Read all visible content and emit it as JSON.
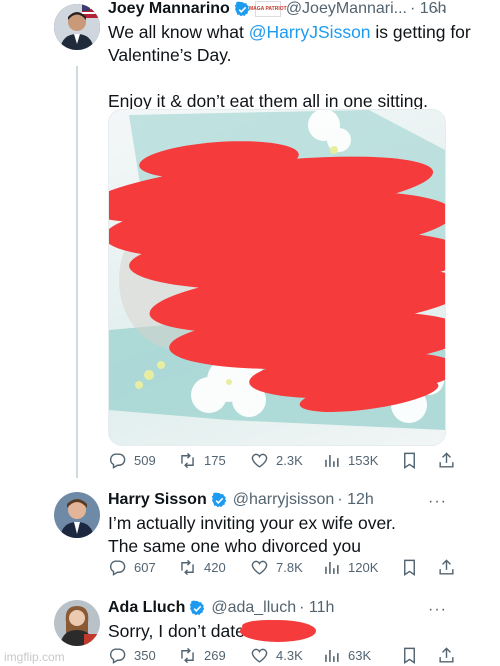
{
  "tweets": [
    {
      "name": "Joey Mannarino",
      "badge_label": "MAGA PATRIOT",
      "handle": "@JoeyMannari...",
      "time": "· 16h",
      "text_before_mention": "We all know what ",
      "mention": "@HarryJSisson",
      "text_after_mention": " is getting for Valentine’s Day.\n\nEnjoy it & don’t eat them all in one sitting.",
      "stats": {
        "replies": "509",
        "retweets": "175",
        "likes": "2.3K",
        "views": "153K"
      }
    },
    {
      "name": "Harry Sisson",
      "handle": "@harryjsisson",
      "time": "· 12h",
      "text": "I’m actually inviting your ex wife over. The same one who divorced you",
      "stats": {
        "replies": "607",
        "retweets": "420",
        "likes": "7.8K",
        "views": "120K"
      }
    },
    {
      "name": "Ada Lluch",
      "handle": "@ada_lluch",
      "time": "· 11h",
      "text": "Sorry, I don’t date",
      "stats": {
        "replies": "350",
        "retweets": "269",
        "likes": "4.3K",
        "views": "63K"
      }
    }
  ],
  "more_glyph": "···",
  "colors": {
    "accent": "#1d9bf0",
    "redaction": "#f53b3b",
    "muted": "#536471"
  },
  "watermark": "imgflip.com"
}
